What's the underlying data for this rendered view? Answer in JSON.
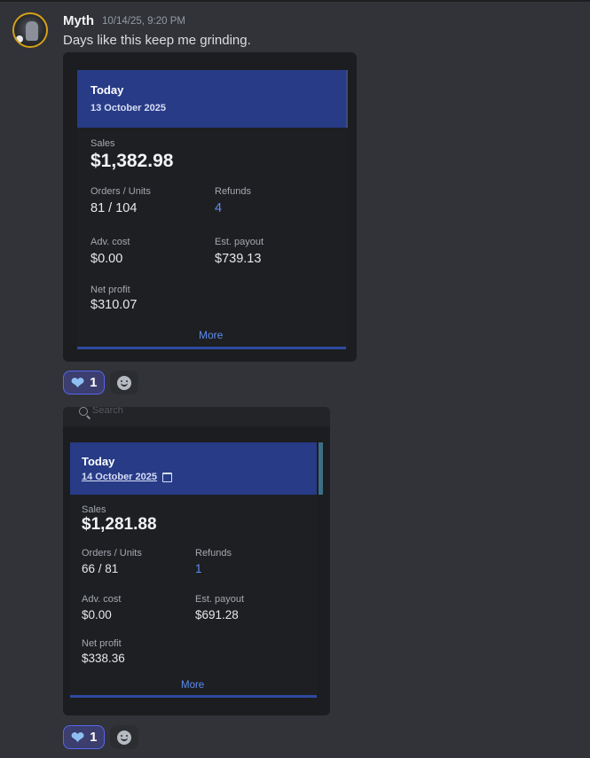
{
  "message": {
    "author": "Myth",
    "timestamp": "10/14/25, 9:20 PM",
    "text": "Days like this keep me grinding."
  },
  "attachments": [
    {
      "header_title": "Today",
      "header_date": "13 October 2025",
      "sales_label": "Sales",
      "sales_value": "$1,382.98",
      "orders_label": "Orders / Units",
      "orders_value": "81 / 104",
      "refunds_label": "Refunds",
      "refunds_value": "4",
      "adv_label": "Adv. cost",
      "adv_value": "$0.00",
      "payout_label": "Est. payout",
      "payout_value": "$739.13",
      "profit_label": "Net profit",
      "profit_value": "$310.07",
      "more_label": "More"
    },
    {
      "search_placeholder": "Search",
      "header_title": "Today",
      "header_date": "14 October 2025",
      "sales_label": "Sales",
      "sales_value": "$1,281.88",
      "orders_label": "Orders / Units",
      "orders_value": "66 / 81",
      "refunds_label": "Refunds",
      "refunds_value": "1",
      "adv_label": "Adv. cost",
      "adv_value": "$0.00",
      "payout_label": "Est. payout",
      "payout_value": "$691.28",
      "profit_label": "Net profit",
      "profit_value": "$338.36",
      "more_label": "More"
    }
  ],
  "reactions": [
    {
      "icon": "heart-icon",
      "count": "1"
    },
    {
      "icon": "heart-icon",
      "count": "1"
    }
  ],
  "colors": {
    "background": "#313338",
    "header_blue": "#273b86",
    "link_blue": "#5b8cf0",
    "reaction_border": "#5865f2"
  }
}
